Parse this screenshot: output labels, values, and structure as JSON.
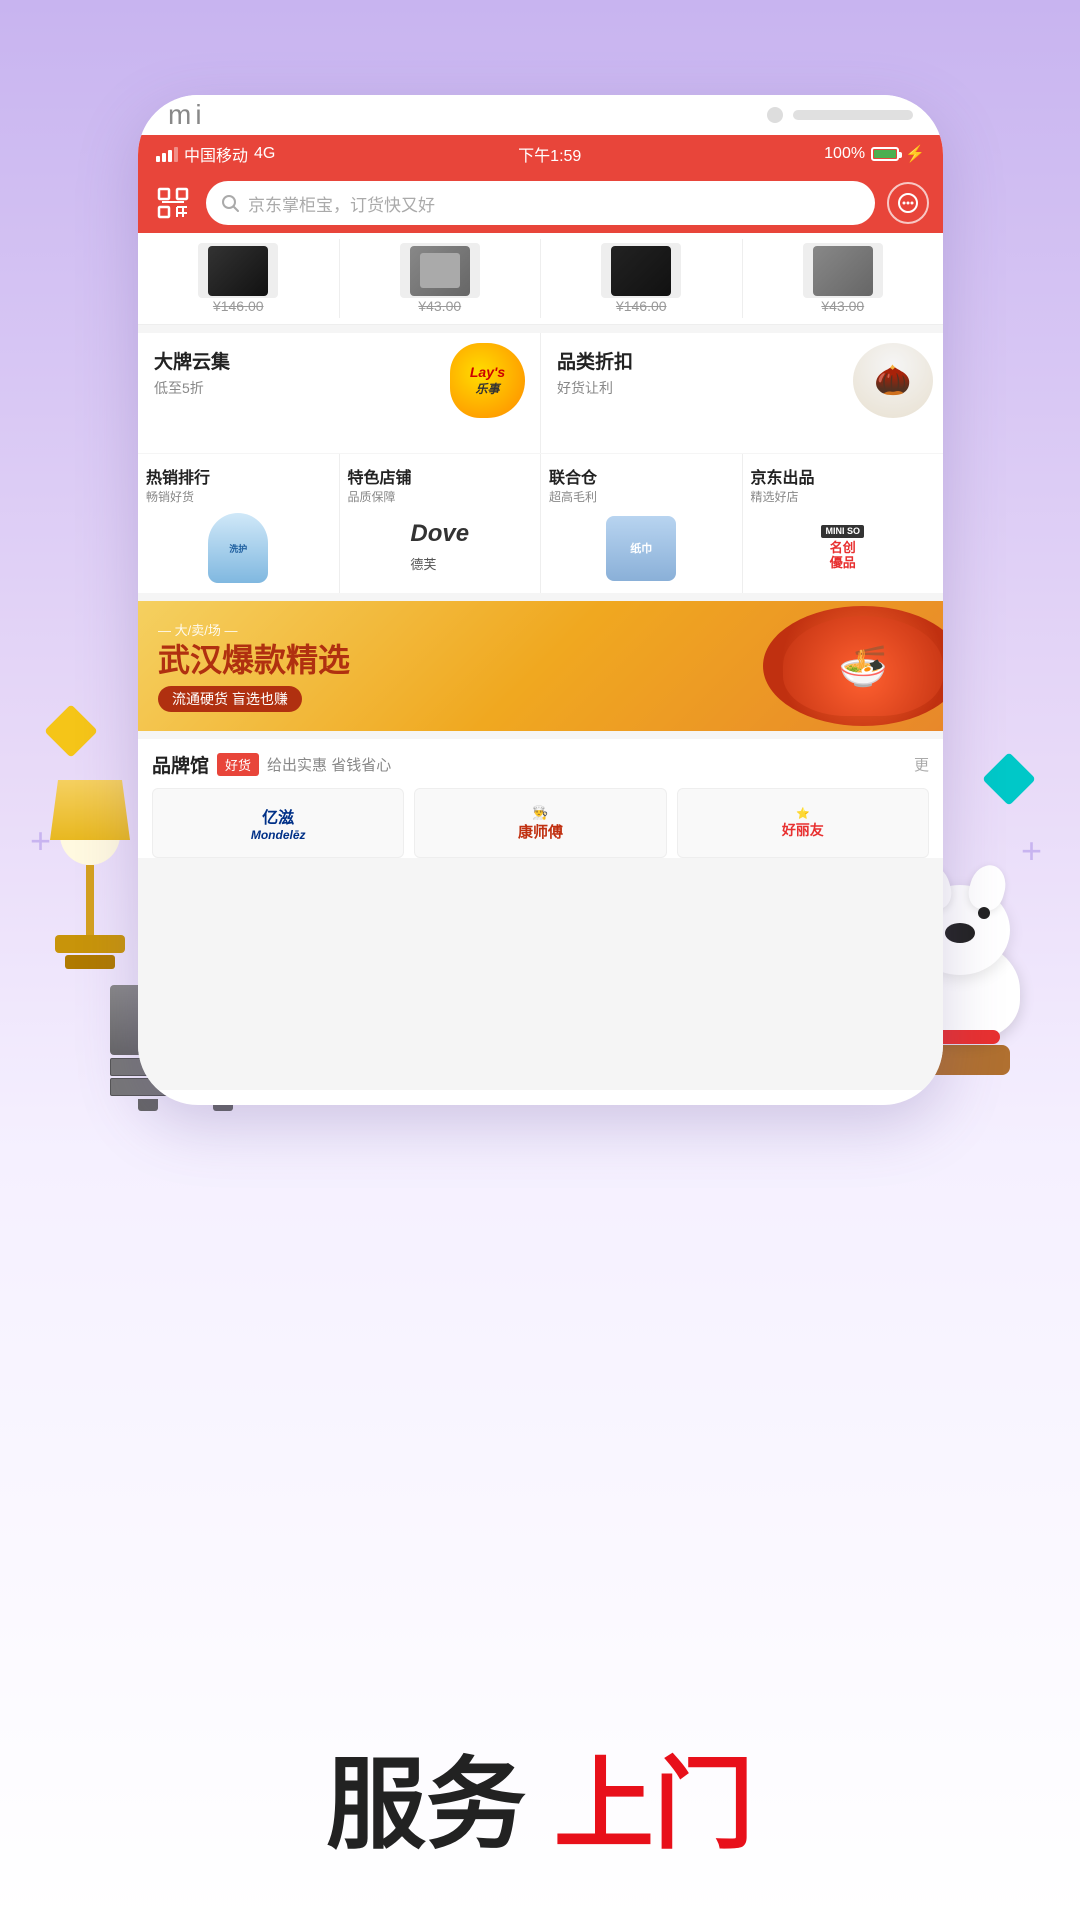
{
  "background": {
    "gradient_start": "#c8b4f0",
    "gradient_end": "#ffffff"
  },
  "phone": {
    "brand": "mi",
    "status_bar": {
      "carrier": "中国移动",
      "network": "4G",
      "time": "下午1:59",
      "battery": "100%"
    },
    "search_bar": {
      "placeholder": "京东掌柜宝，订货快又好"
    },
    "product_strip": [
      {
        "price": "¥146.00"
      },
      {
        "price": "¥43.00"
      },
      {
        "price": "¥146.00"
      },
      {
        "price": "¥43.00"
      }
    ],
    "categories": [
      {
        "title": "大牌云集",
        "subtitle": "低至5折",
        "image_alt": "lays-chip"
      },
      {
        "title": "品类折扣",
        "subtitle": "好货让利",
        "image_alt": "nuts-bowl"
      }
    ],
    "hot_row": [
      {
        "title": "热销排行",
        "subtitle": "畅销好货",
        "image_alt": "detergent"
      },
      {
        "title": "特色店铺",
        "subtitle": "品质保障",
        "image_alt": "dove"
      },
      {
        "title": "联合仓",
        "subtitle": "超高毛利",
        "image_alt": "tissue"
      },
      {
        "title": "京东出品",
        "subtitle": "精选好店",
        "image_alt": "miniso"
      }
    ],
    "banner": {
      "venue": "— 大/卖/场 —",
      "title": "武汉爆款精选",
      "tag": "流通硬货 盲选也赚"
    },
    "brand_section": {
      "title": "品牌馆",
      "tag": "好货",
      "desc": "给出实惠 省钱省心",
      "more": "更",
      "brands": [
        {
          "name": "亿滋 Mondelez"
        },
        {
          "name": "康师傅"
        },
        {
          "name": "好丽友"
        }
      ]
    }
  },
  "headline": {
    "black_text": "服务",
    "red_text": "上门"
  }
}
